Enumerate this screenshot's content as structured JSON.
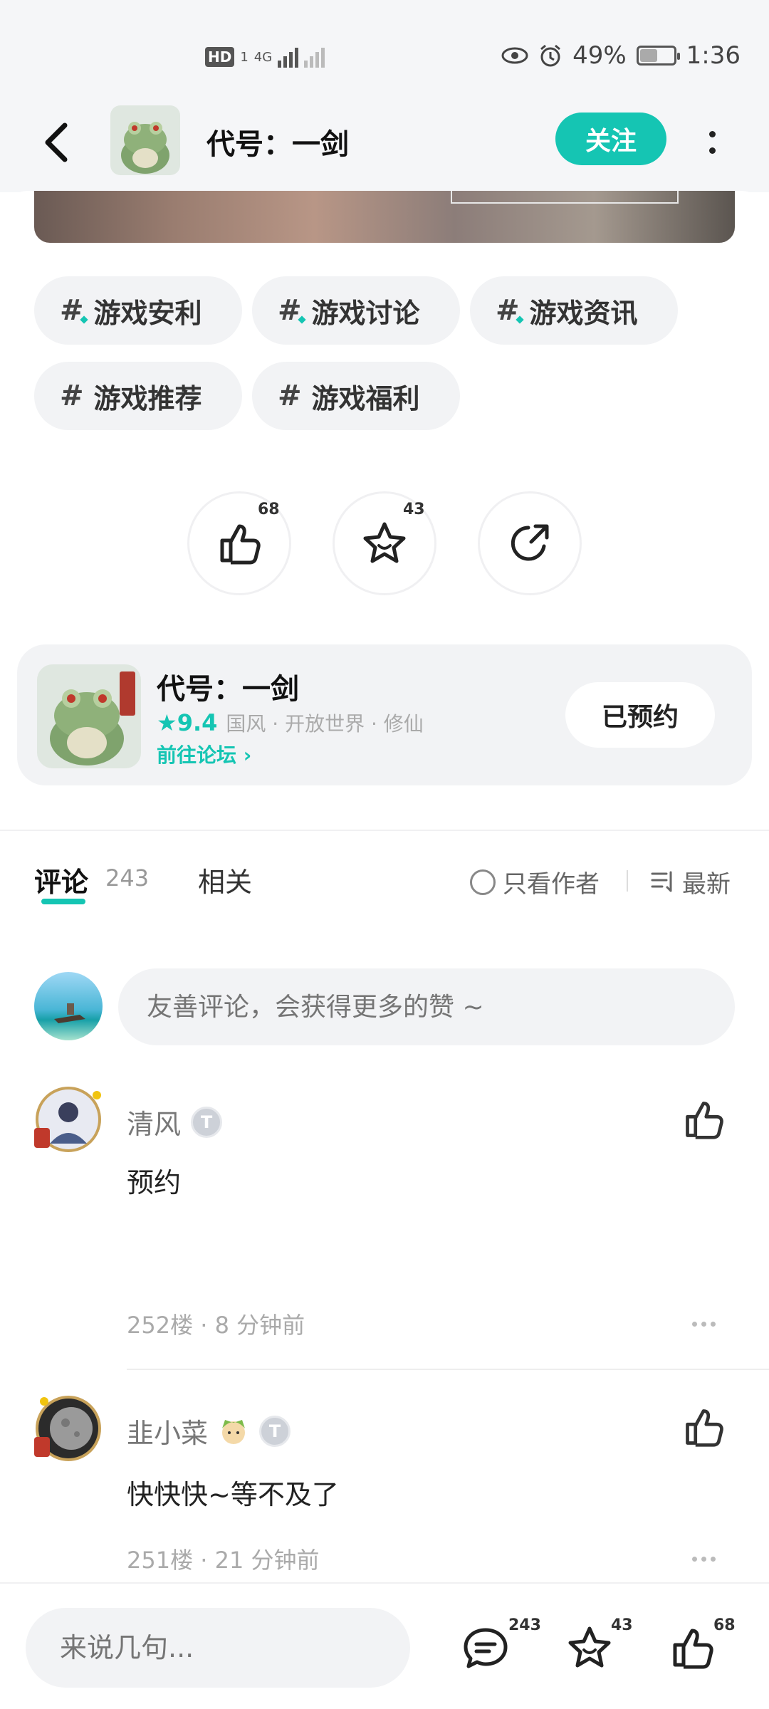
{
  "status_bar": {
    "network_hd": "HD",
    "network_sim": "1",
    "network_type": "4G",
    "battery": "49%",
    "time": "1:36"
  },
  "header": {
    "title": "代号：一剑",
    "follow_label": "关注"
  },
  "tags": [
    "游戏安利",
    "游戏讨论",
    "游戏资讯",
    "游戏推荐",
    "游戏福利"
  ],
  "actions": {
    "like_count": "68",
    "favorite_count": "43"
  },
  "game_card": {
    "name": "代号：一剑",
    "rating": "9.4",
    "genres": "国风 · 开放世界 · 修仙",
    "forum_link": "前往论坛",
    "reserve_label": "已预约"
  },
  "tabs": {
    "comments_label": "评论",
    "comments_count": "243",
    "related_label": "相关",
    "author_only_label": "只看作者",
    "sort_label": "最新"
  },
  "comment_input": {
    "placeholder": "友善评论，会获得更多的赞 ~"
  },
  "comments": [
    {
      "user": "清风",
      "text": "预约",
      "floor": "252楼",
      "time": "8 分钟前"
    },
    {
      "user": "韭小菜",
      "text": "快快快~等不及了",
      "floor": "251楼",
      "time": "21 分钟前"
    }
  ],
  "bottom_bar": {
    "placeholder": "来说几句...",
    "comment_count": "243",
    "favorite_count": "43",
    "like_count": "68"
  },
  "colors": {
    "accent": "#15c5b3",
    "background": "#ffffff",
    "chip": "#f2f3f5"
  }
}
